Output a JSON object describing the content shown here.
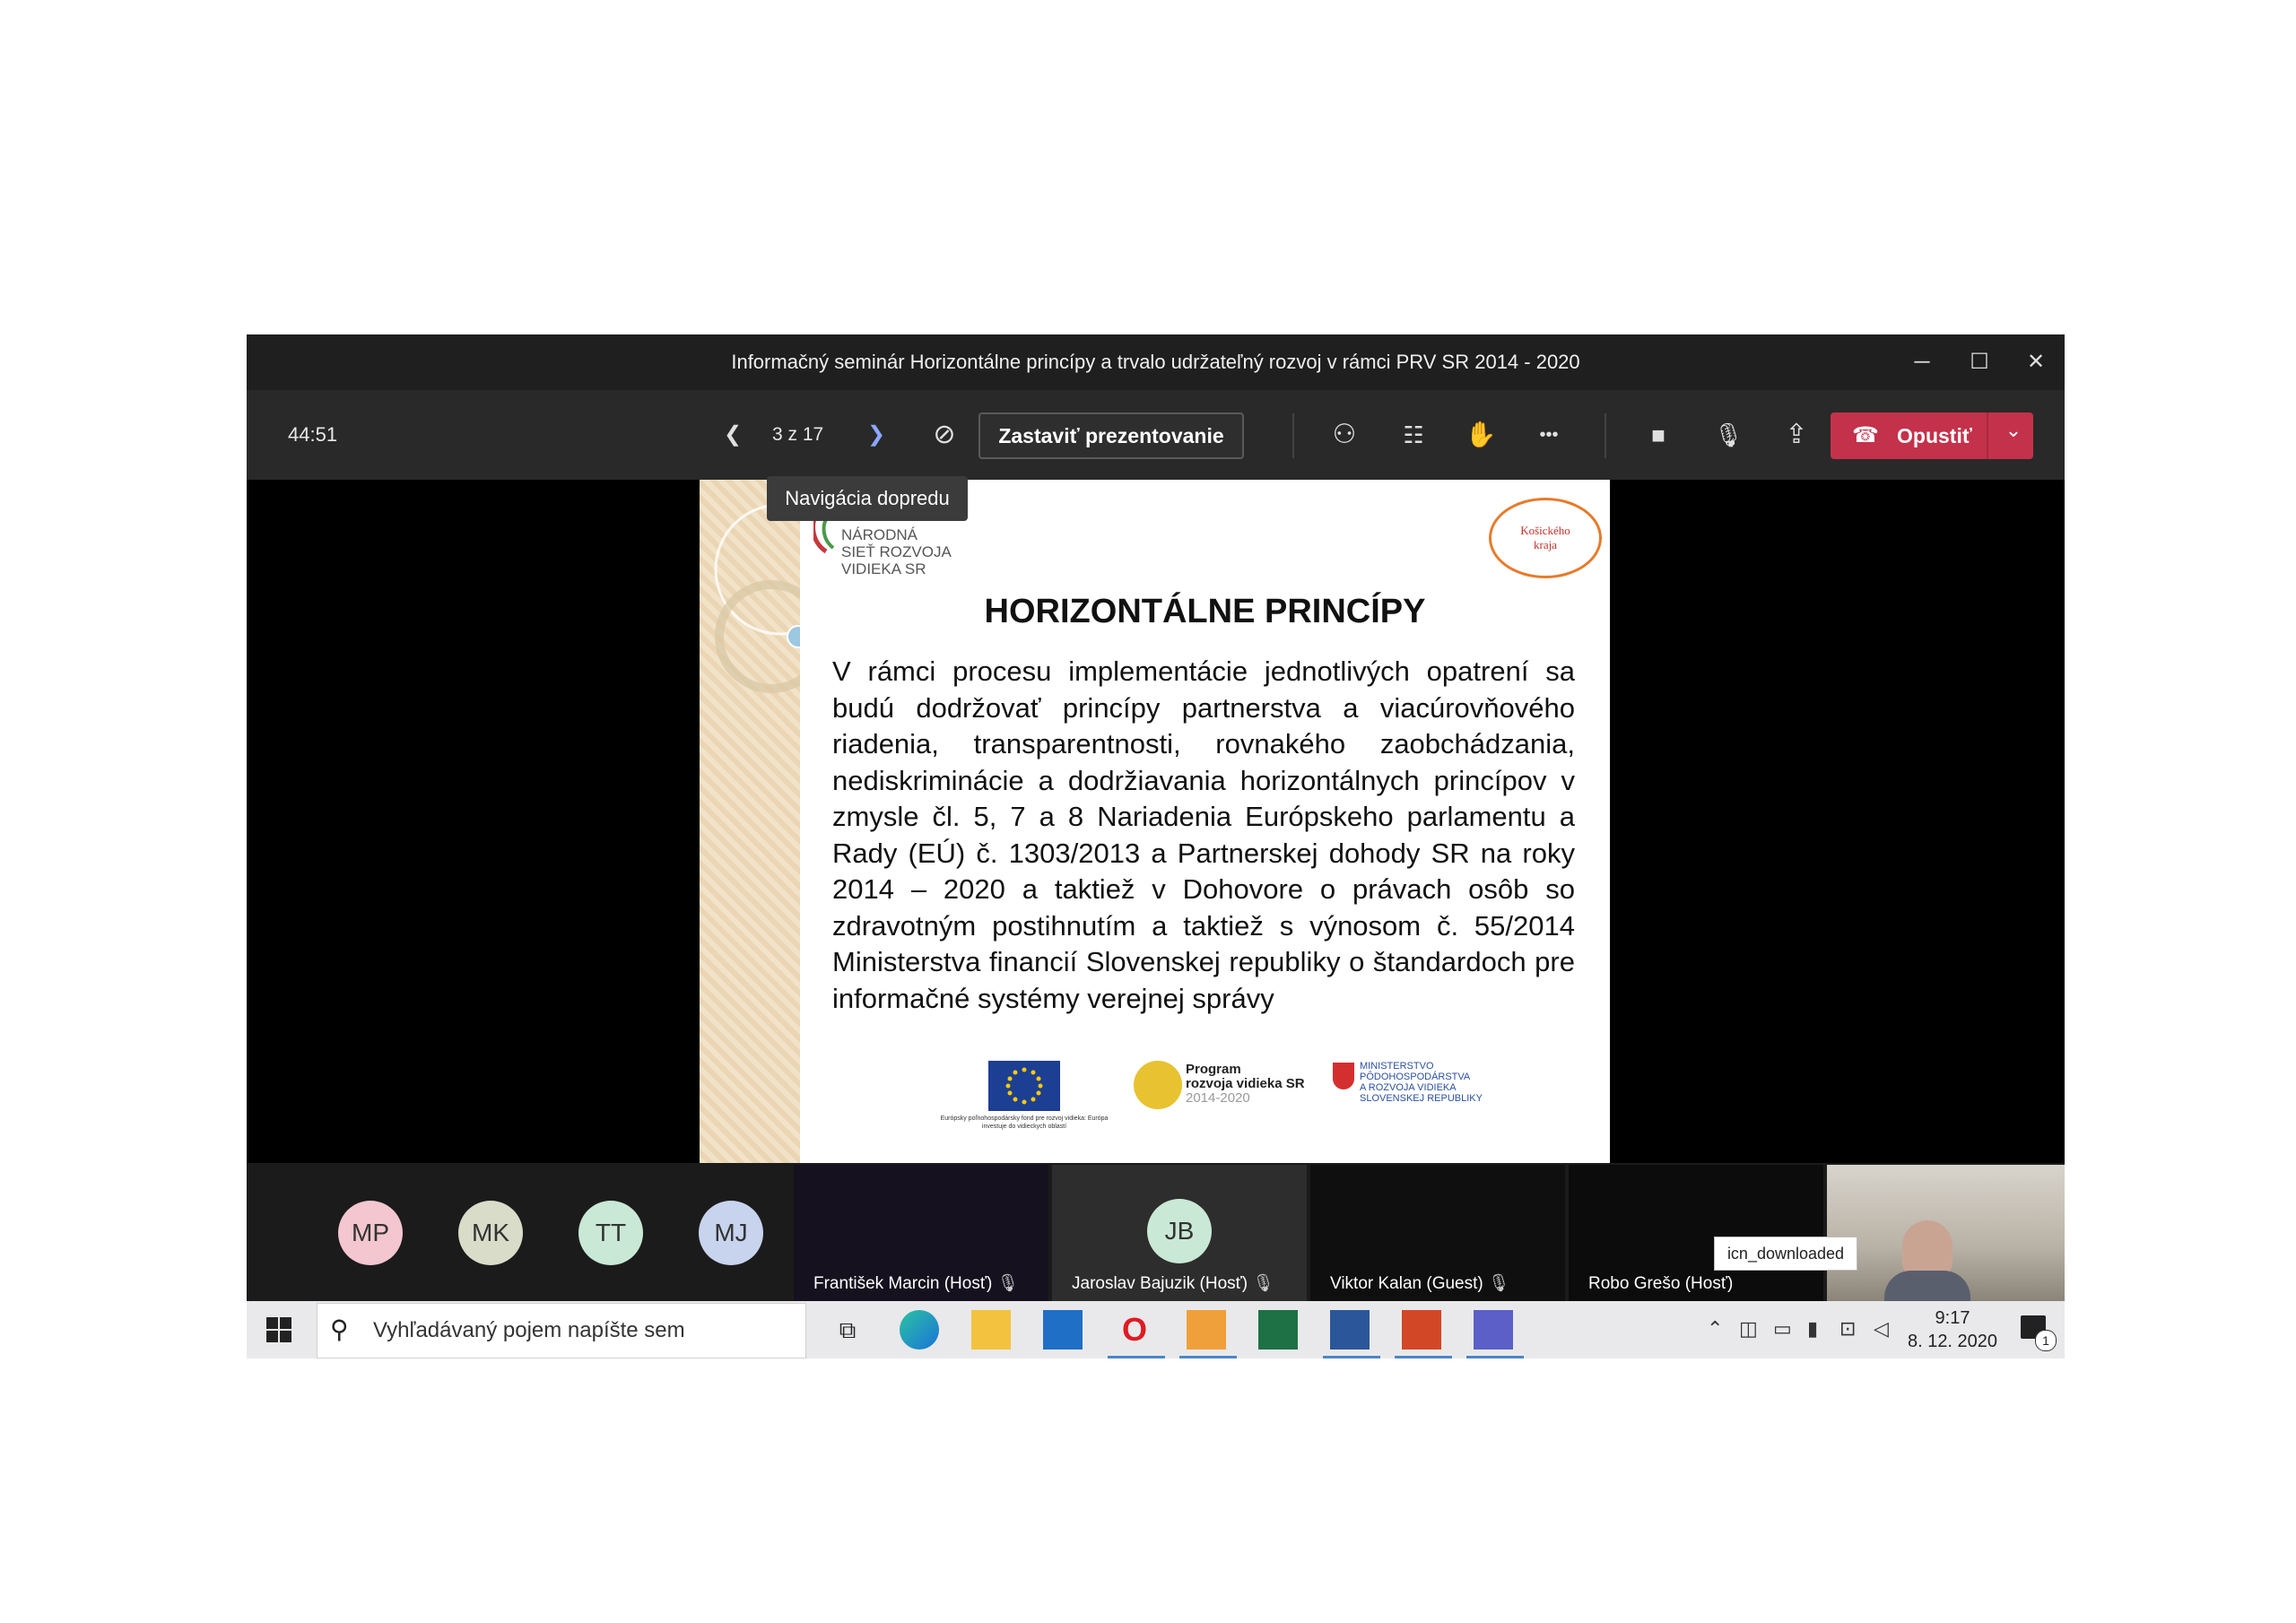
{
  "window": {
    "title": "Informačný seminár Horizontálne princípy a trvalo udržateľný rozvoj v rámci PRV SR 2014 - 2020",
    "minimize_glyph": "─",
    "maximize_glyph": "☐",
    "close_glyph": "✕"
  },
  "toolbar": {
    "timer": "44:51",
    "prev_glyph": "❮",
    "next_glyph": "❯",
    "slide_counter": "3 z 17",
    "hide_glyph": "⊘",
    "stop_label": "Zastaviť prezentovanie",
    "people_glyph": "⚇",
    "chat_glyph": "☷",
    "hand_glyph": "✋",
    "more_glyph": "•••",
    "camera_glyph": "■",
    "mic_glyph": "🎙",
    "share_glyph": "⇪",
    "leave_label": "Opustiť",
    "leave_phone_glyph": "☎",
    "leave_chevron_glyph": "⌄",
    "tooltip": "Navigácia dopredu"
  },
  "slide": {
    "logo_left_lines": [
      "NÁRODNÁ",
      "SIEŤ ROZVOJA",
      "VIDIEKA SR"
    ],
    "logo_right_text": "Košického kraja",
    "title": "HORIZONTÁLNE PRINCÍPY",
    "body": "V rámci procesu implementácie jednotlivých opatrení sa budú dodržovať princípy partnerstva a viacúrovňového riadenia, transparentnosti, rovnakého zaobchádzania, nediskriminácie a dodržiavania horizontálnych princípov v zmysle čl. 5, 7 a 8 Nariadenia Európskeho parlamentu a Rady (EÚ) č. 1303/2013 a Partnerskej dohody SR na roky 2014 – 2020 a taktiež v Dohovore o právach osôb so zdravotným postihnutím a taktiež s výnosom č. 55/2014 Ministerstva financií Slovenskej republiky o štandardoch pre informačné systémy verejnej správy",
    "footer_eu_caption": "Európsky poľnohospodársky fond pre rozvoj vidieka: Európa investuje do vidieckych oblastí",
    "footer_prv_lines": [
      "Program",
      "rozvoja vidieka SR",
      "2014-2020"
    ],
    "footer_ministry_lines": [
      "MINISTERSTVO",
      "PÔDOHOSPODÁRSTVA",
      "A ROZVOJA VIDIEKA",
      "SLOVENSKEJ REPUBLIKY"
    ]
  },
  "participants": {
    "avatars": [
      {
        "initials": "MP",
        "color": "#f3c6d0"
      },
      {
        "initials": "MK",
        "color": "#d9dcc9"
      },
      {
        "initials": "TT",
        "color": "#c9e8d5"
      },
      {
        "initials": "MJ",
        "color": "#c8d3ee"
      }
    ],
    "tiles": [
      {
        "name": "František Marcin (Hosť)"
      },
      {
        "name": "Jaroslav Bajuzik (Hosť)",
        "initials": "JB"
      },
      {
        "name": "Viktor Kalan (Guest)"
      },
      {
        "name": "Robo Grešo (Hosť)"
      }
    ],
    "muted_glyph": "🎙",
    "tooltip_downloaded": "icn_downloaded"
  },
  "taskbar": {
    "search_placeholder": "Vyhľadávaný pojem napíšte sem",
    "time": "9:17",
    "date": "8. 12. 2020",
    "notification_count": "1"
  },
  "colors": {
    "leave_red": "#c4314b",
    "toolbar_bg": "#292929",
    "titlebar_bg": "#1f1f1f"
  }
}
